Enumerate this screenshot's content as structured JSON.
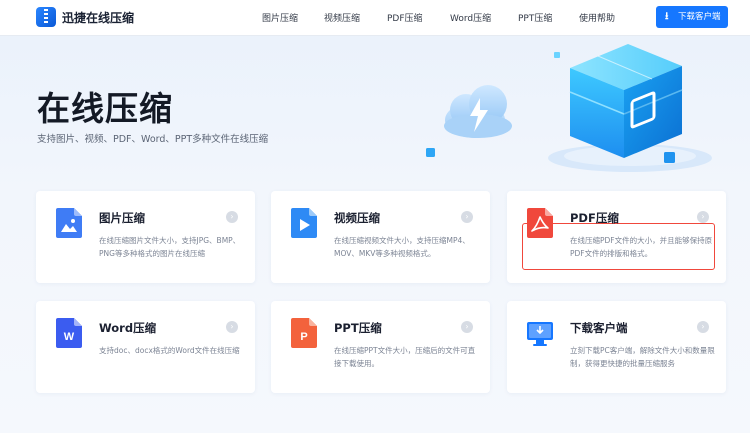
{
  "header": {
    "logo_text": "迅捷在线压缩",
    "nav": [
      "图片压缩",
      "视频压缩",
      "PDF压缩",
      "Word压缩",
      "PPT压缩",
      "使用帮助"
    ],
    "download_label": "下载客户端",
    "accent": "#1677ff"
  },
  "hero": {
    "title": "在线压缩",
    "subtitle": "支持图片、视频、PDF、Word、PPT多种文件在线压缩"
  },
  "cards": [
    {
      "title": "图片压缩",
      "desc": "在线压缩图片文件大小，支持JPG、BMP、PNG等多种格式的图片在线压缩",
      "icon": "image-file-icon",
      "color": "#3f7cf5"
    },
    {
      "title": "视频压缩",
      "desc": "在线压缩视频文件大小，支持压缩MP4、MOV、MKV等多种视频格式。",
      "icon": "video-file-icon",
      "color": "#2e8af5"
    },
    {
      "title": "PDF压缩",
      "desc": "在线压缩PDF文件的大小，并且能够保持原PDF文件的排版和格式。",
      "icon": "pdf-file-icon",
      "color": "#f0483c",
      "active": true
    },
    {
      "title": "Word压缩",
      "desc": "支持doc、docx格式的Word文件在线压缩",
      "icon": "word-file-icon",
      "color": "#3b5cf0"
    },
    {
      "title": "PPT压缩",
      "desc": "在线压缩PPT文件大小，压缩后的文件可直接下载使用。",
      "icon": "ppt-file-icon",
      "color": "#f3623c"
    },
    {
      "title": "下载客户端",
      "desc": "立刻下载PC客户端，解除文件大小和数量限制，获得更快捷的批量压缩服务",
      "icon": "desktop-download-icon",
      "color": "#1677ff"
    }
  ]
}
